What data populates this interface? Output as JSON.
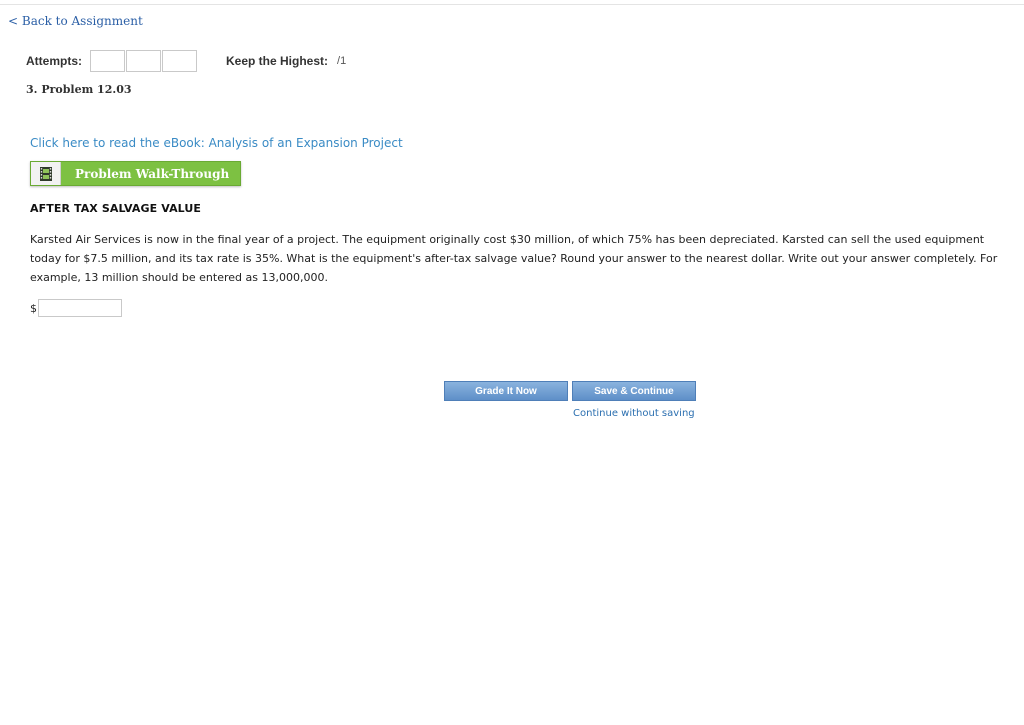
{
  "nav": {
    "back_label": "< Back to Assignment"
  },
  "attempts": {
    "label": "Attempts:",
    "keep_label": "Keep the Highest:",
    "score": "/1"
  },
  "problem": {
    "title": "3. Problem 12.03",
    "ebook_link": "Click here to read the eBook: Analysis of an Expansion Project",
    "walkthrough_label": "Problem Walk-Through",
    "heading": "AFTER TAX SALVAGE VALUE",
    "body": "Karsted Air Services is now in the final year of a project. The equipment originally cost $30 million, of which 75% has been depreciated. Karsted can sell the used equipment today for $7.5 million, and its tax rate is 35%. What is the equipment's after-tax salvage value? Round your answer to the nearest dollar. Write out your answer completely. For example, 13 million should be entered as 13,000,000.",
    "currency_symbol": "$",
    "answer_value": ""
  },
  "actions": {
    "grade_label": "Grade It Now",
    "save_label": "Save & Continue",
    "continue_label": "Continue without saving"
  },
  "colors": {
    "link": "#2b5fa6",
    "walkthrough_green": "#7dc142",
    "button_blue": "#5e8fc8"
  }
}
